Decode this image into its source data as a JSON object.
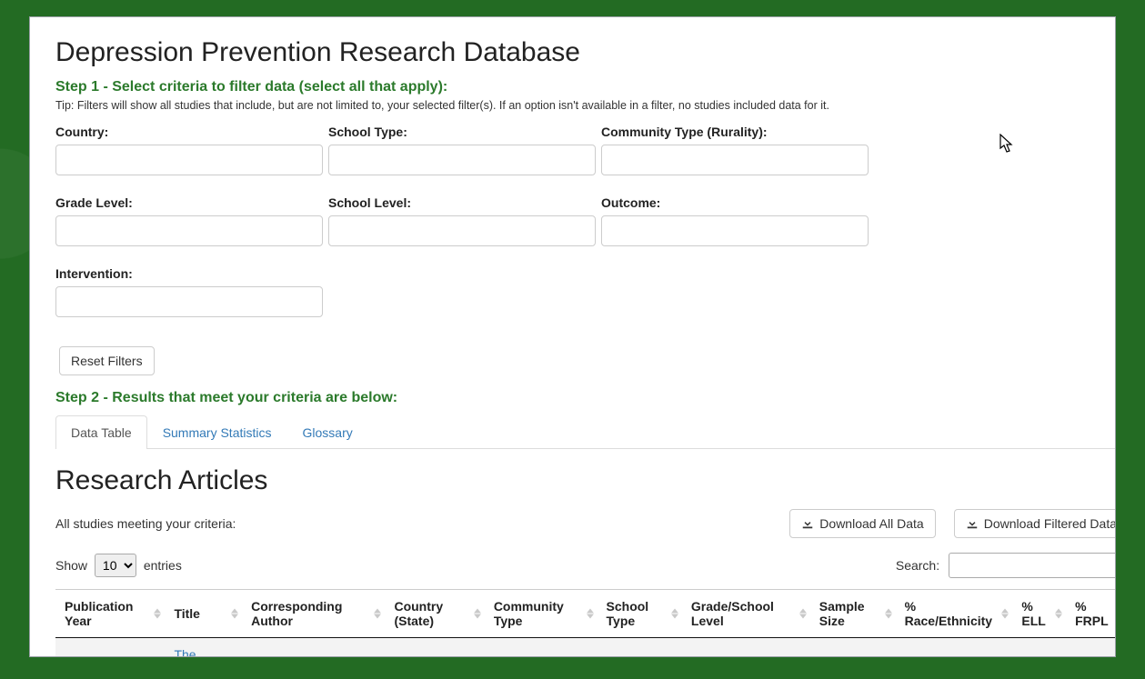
{
  "page": {
    "title": "Depression Prevention Research Database"
  },
  "step1": {
    "heading": "Step 1 - Select criteria to filter data (select all that apply):",
    "tip": "Tip: Filters will show all studies that include, but are not limited to, your selected filter(s). If an option isn't available in a filter, no studies included data for it."
  },
  "filters": {
    "country": {
      "label": "Country:"
    },
    "school_type": {
      "label": "School Type:"
    },
    "community_type": {
      "label": "Community Type (Rurality):"
    },
    "grade_level": {
      "label": "Grade Level:"
    },
    "school_level": {
      "label": "School Level:"
    },
    "outcome": {
      "label": "Outcome:"
    },
    "intervention": {
      "label": "Intervention:"
    }
  },
  "reset_button": "Reset Filters",
  "step2": {
    "heading": "Step 2 - Results that meet your criteria are below:"
  },
  "tabs": {
    "data_table": "Data Table",
    "summary_stats": "Summary Statistics",
    "glossary": "Glossary"
  },
  "results": {
    "section_title": "Research Articles",
    "subtext": "All studies meeting your criteria:",
    "download_all": "Download All Data",
    "download_filtered": "Download Filtered Data",
    "show_prefix": "Show",
    "show_suffix": "entries",
    "page_size_selected": "10",
    "search_label": "Search:"
  },
  "columns": [
    "Publication Year",
    "Title",
    "Corresponding Author",
    "Country (State)",
    "Community Type",
    "School Type",
    "Grade/School Level",
    "Sample Size",
    "% Race/Ethnicity",
    "% ELL",
    "% FRPL"
  ],
  "rows": [
    {
      "title_fragment": "The Unified"
    }
  ]
}
